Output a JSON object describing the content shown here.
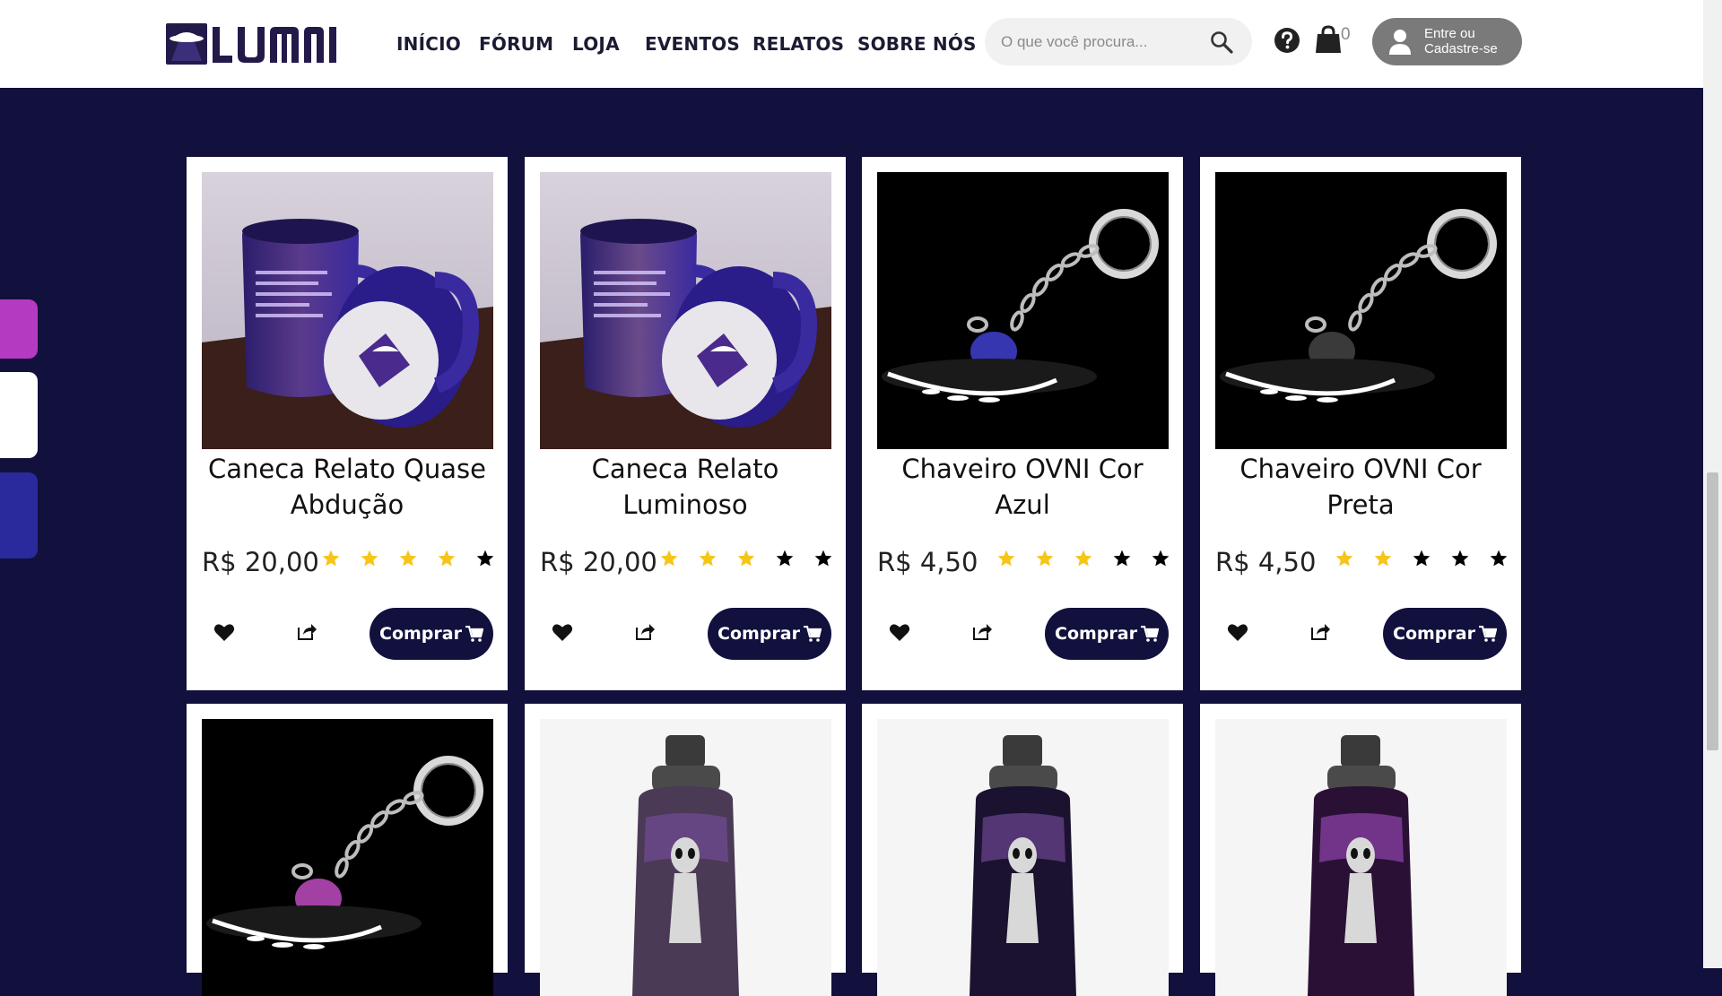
{
  "header": {
    "logo_text": "LUMNI",
    "nav": [
      "INÍCIO",
      "FÓRUM",
      "LOJA",
      "EVENTOS",
      "RELATOS",
      "SOBRE NÓS"
    ],
    "search_placeholder": "O que você procura...",
    "cart_count": "0",
    "login_line1": "Entre ou",
    "login_line2": "Cadastre-se"
  },
  "side_tabs": [
    {
      "color": "#b53ac2"
    },
    {
      "color": "#ffffff"
    },
    {
      "color": "#2a2a9c"
    }
  ],
  "products": [
    {
      "title_line1": "Caneca Relato Quase",
      "title_line2": "Abdução",
      "price": "R$ 20,00",
      "rating": 4,
      "buy_label": "Comprar",
      "image": "mug-icon"
    },
    {
      "title_line1": "Caneca Relato",
      "title_line2": "Luminoso",
      "price": "R$ 20,00",
      "rating": 3,
      "buy_label": "Comprar",
      "image": "mug-icon"
    },
    {
      "title_line1": "Chaveiro OVNI Cor",
      "title_line2": "Azul",
      "price": "R$ 4,50",
      "rating": 3,
      "buy_label": "Comprar",
      "image": "ufo-keychain-icon"
    },
    {
      "title_line1": "Chaveiro OVNI Cor",
      "title_line2": "Preta",
      "price": "R$ 4,50",
      "rating": 2,
      "buy_label": "Comprar",
      "image": "ufo-keychain-icon"
    }
  ],
  "products_row2": [
    {
      "image": "ufo-keychain-icon"
    },
    {
      "image": "bottle-icon"
    },
    {
      "image": "bottle-icon"
    },
    {
      "image": "bottle-icon"
    }
  ],
  "colors": {
    "navy": "#12103d",
    "star_gold": "#f5c518",
    "star_empty": "#000000",
    "login_bg": "#7a7a7a"
  }
}
